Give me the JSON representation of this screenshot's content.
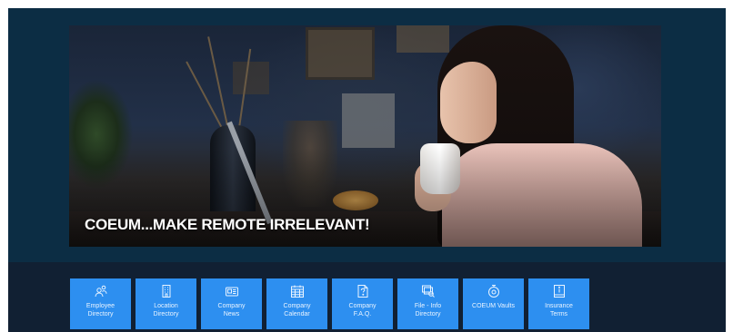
{
  "hero": {
    "caption": "COEUM...MAKE REMOTE IRRELEVANT!"
  },
  "tiles": [
    {
      "label": "Employee\nDirectory",
      "icon": "people-icon"
    },
    {
      "label": "Location\nDirectory",
      "icon": "building-icon"
    },
    {
      "label": "Company\nNews",
      "icon": "newspaper-icon"
    },
    {
      "label": "Company\nCalendar",
      "icon": "calendar-icon"
    },
    {
      "label": "Company\nF.A.Q.",
      "icon": "question-doc-icon"
    },
    {
      "label": "File - Info\nDirectory",
      "icon": "file-search-icon"
    },
    {
      "label": "COEUM Vaults",
      "icon": "vault-icon"
    },
    {
      "label": "Insurance\nTerms",
      "icon": "info-book-icon"
    }
  ],
  "colors": {
    "background": "#0b2a3e",
    "tile_bg": "#2d8ff0",
    "bottom_band": "#112033"
  }
}
